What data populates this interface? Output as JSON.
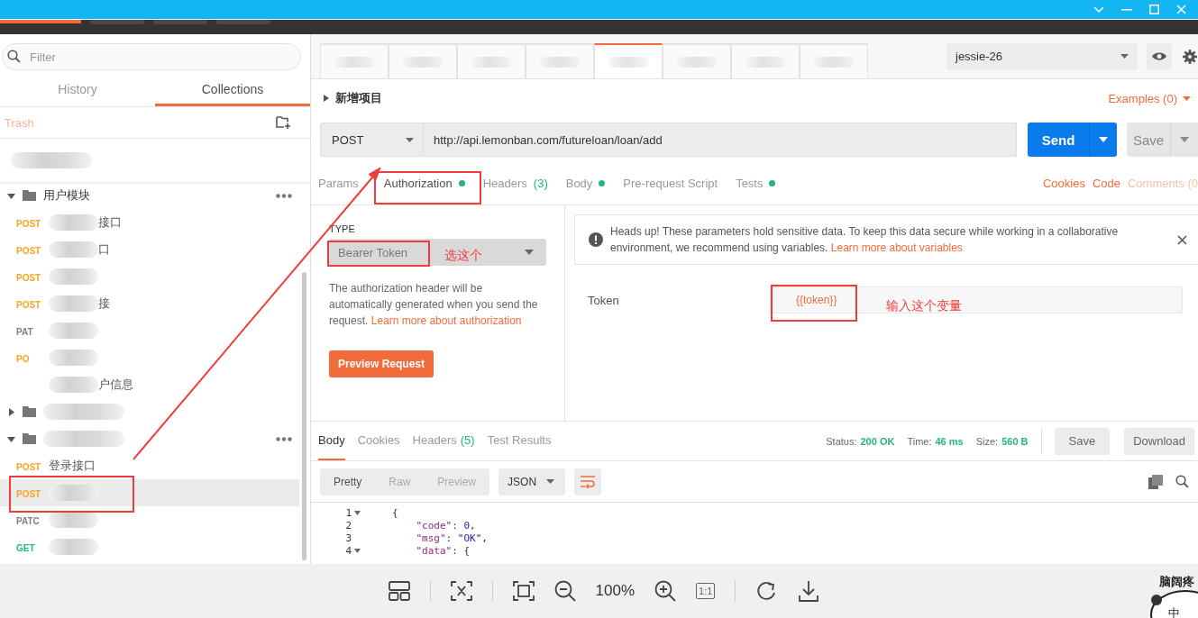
{
  "sidebar": {
    "filter_placeholder": "Filter",
    "tabs": [
      {
        "label": "History",
        "selected": false
      },
      {
        "label": "Collections",
        "selected": true
      }
    ],
    "trash": "Trash",
    "tree": [
      {
        "kind": "blurred"
      },
      {
        "kind": "folder",
        "name": "用户模块",
        "expanded": true,
        "children": [
          {
            "method": "POST",
            "color": "#f5a623",
            "blurred": true,
            "name": "接口",
            "selected": false
          },
          {
            "method": "POST",
            "color": "#f5a623",
            "blurred": true,
            "name": "口",
            "selected": false
          },
          {
            "method": "POST",
            "color": "#f5a623",
            "blurred": true,
            "selected": false
          },
          {
            "method": "POST",
            "color": "#f5a623",
            "blurred": true,
            "name": "接",
            "selected": false
          },
          {
            "method": "PAT",
            "color": "#808080",
            "blurred": true,
            "selected": false
          },
          {
            "method": "PO",
            "color": "#f5a623",
            "blurred": true,
            "selected": false
          },
          {
            "blurred": true,
            "name": "户信息",
            "selected": false
          }
        ]
      },
      {
        "kind": "folder",
        "blurred": true,
        "expanded": false
      },
      {
        "kind": "folder",
        "blurred": true,
        "expanded": true,
        "children": [
          {
            "method": "POST",
            "color": "#f5a623",
            "blurred": false,
            "name": "登录接口",
            "selected": false
          },
          {
            "method": "POST",
            "color": "#f5a623",
            "blurred": true,
            "selected": true
          },
          {
            "method": "PATC",
            "color": "#808080",
            "blurred": true,
            "selected": false
          },
          {
            "method": "GET",
            "color": "#26b47f",
            "blurred": true,
            "selected": false
          }
        ]
      }
    ]
  },
  "tabs": [
    {
      "selected": false
    },
    {
      "selected": false
    },
    {
      "selected": false
    },
    {
      "selected": false
    },
    {
      "selected": true
    },
    {
      "selected": false
    },
    {
      "selected": false
    },
    {
      "selected": false
    }
  ],
  "environment": "jessie-26",
  "request": {
    "name": "新增项目",
    "examples": "Examples (0)",
    "method": "POST",
    "url": "http://api.lemonban.com/futureloan/loan/add",
    "send": "Send",
    "save": "Save"
  },
  "request_tabs": [
    {
      "label": "Params",
      "selected": false,
      "dot": false
    },
    {
      "label": "Authorization",
      "selected": true,
      "dot": true
    },
    {
      "label": "Headers",
      "count": "(3)",
      "selected": false,
      "dot": false
    },
    {
      "label": "Body",
      "selected": false,
      "dot": true
    },
    {
      "label": "Pre-request Script",
      "selected": false,
      "dot": false
    },
    {
      "label": "Tests",
      "selected": false,
      "dot": true
    }
  ],
  "request_links": [
    {
      "label": "Cookies",
      "disabled": false
    },
    {
      "label": "Code",
      "disabled": false
    },
    {
      "label": "Comments (0",
      "disabled": true
    }
  ],
  "auth": {
    "type_label": "TYPE",
    "type": "Bearer Token",
    "type_note": "选这个",
    "description": "The authorization header will be automatically generated when you send the request.",
    "description_link": "Learn more about authorization",
    "preview_button": "Preview Request",
    "notice": "Heads up! These parameters hold sensitive data. To keep this data secure while working in a collaborative environment, we recommend using variables.",
    "notice_link": "Learn more about variables",
    "token_label": "Token",
    "token_value": "{{token}}",
    "token_note": "输入这个变量"
  },
  "response": {
    "tabs": [
      {
        "label": "Body",
        "selected": true
      },
      {
        "label": "Cookies",
        "selected": false
      },
      {
        "label": "Headers",
        "count": "(5)",
        "selected": false
      },
      {
        "label": "Test Results",
        "selected": false
      }
    ],
    "status": [
      {
        "label": "Status:",
        "value": "200 OK"
      },
      {
        "label": "Time:",
        "value": "46 ms"
      },
      {
        "label": "Size:",
        "value": "560 B"
      }
    ],
    "save": "Save",
    "download": "Download",
    "views": [
      {
        "label": "Pretty",
        "selected": true
      },
      {
        "label": "Raw",
        "selected": false
      },
      {
        "label": "Preview",
        "selected": false
      }
    ],
    "format": "JSON",
    "code": [
      {
        "number": "1",
        "fold": true,
        "tokens": [
          {
            "kind": "punct",
            "text": "{"
          }
        ]
      },
      {
        "number": "2",
        "fold": false,
        "tokens": [
          {
            "kind": "key",
            "text": "    \"code\""
          },
          {
            "kind": "punct",
            "text": ": "
          },
          {
            "kind": "number",
            "text": "0"
          },
          {
            "kind": "punct",
            "text": ","
          }
        ]
      },
      {
        "number": "3",
        "fold": false,
        "tokens": [
          {
            "kind": "key",
            "text": "    \"msg\""
          },
          {
            "kind": "punct",
            "text": ": "
          },
          {
            "kind": "string",
            "text": "\"OK\""
          },
          {
            "kind": "punct",
            "text": ","
          }
        ]
      },
      {
        "number": "4",
        "fold": true,
        "tokens": [
          {
            "kind": "key",
            "text": "    \"data\""
          },
          {
            "kind": "punct",
            "text": ": {"
          }
        ]
      }
    ]
  },
  "viewer": {
    "zoom": "100%",
    "actual_size": "1:1",
    "sticker_caption": "脑阔疼",
    "sticker_text": "中"
  }
}
